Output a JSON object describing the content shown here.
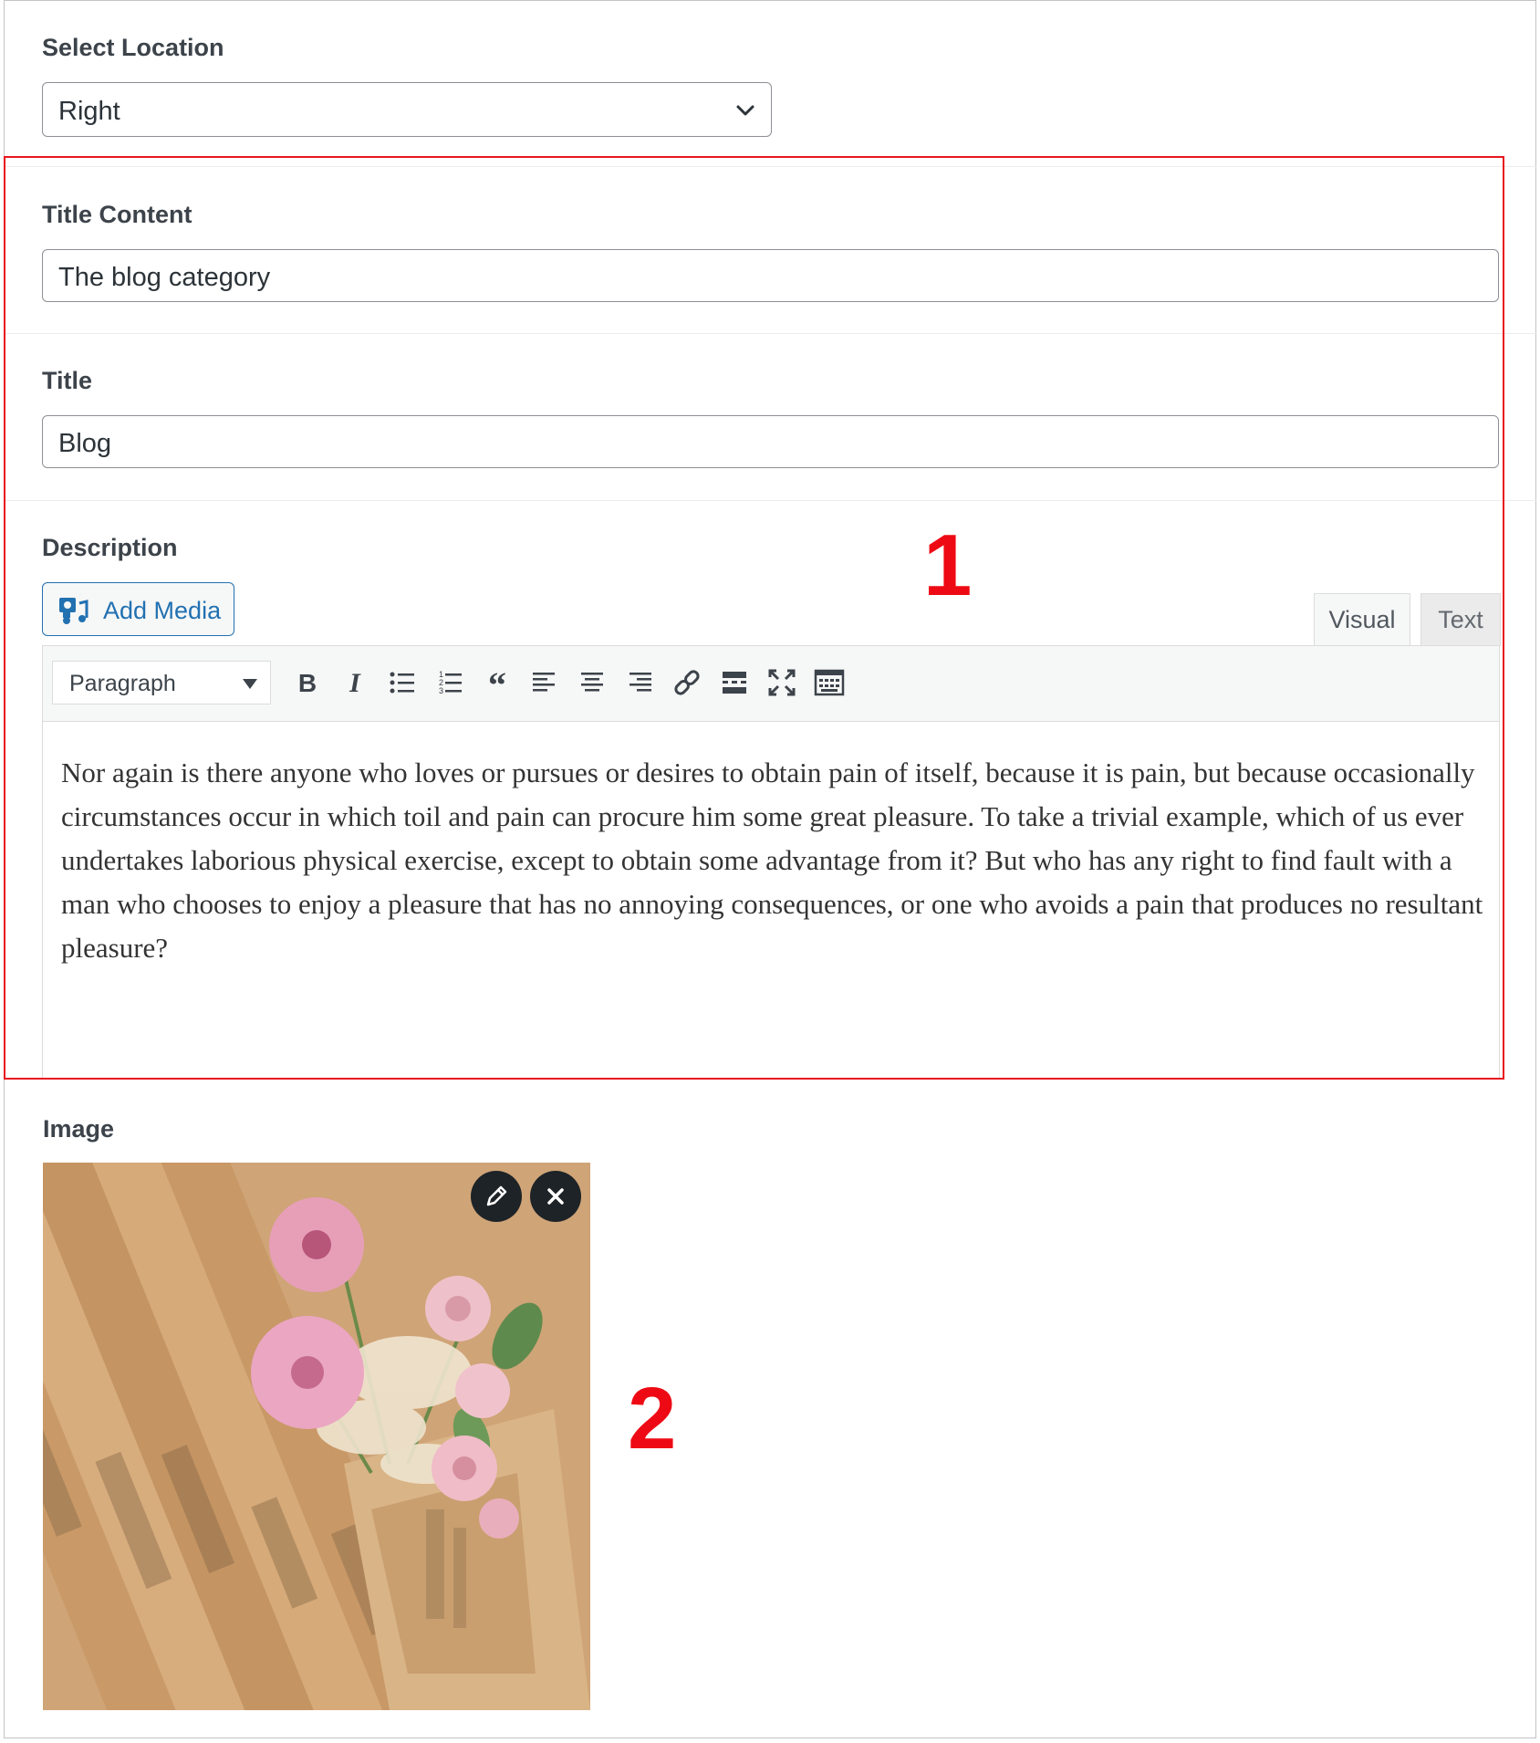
{
  "location": {
    "label": "Select Location",
    "selected": "Right",
    "icon": "chevron-down-icon"
  },
  "title_content": {
    "label": "Title Content",
    "value": "The blog category"
  },
  "title": {
    "label": "Title",
    "value": "Blog"
  },
  "description": {
    "label": "Description",
    "add_media_label": "Add Media",
    "tabs": {
      "visual": "Visual",
      "text": "Text"
    },
    "format_select": "Paragraph",
    "toolbar_icons": [
      "bold-icon",
      "italic-icon",
      "bulleted-list-icon",
      "numbered-list-icon",
      "blockquote-icon",
      "align-left-icon",
      "align-center-icon",
      "align-right-icon",
      "link-icon",
      "read-more-icon",
      "fullscreen-icon",
      "toolbar-toggle-icon"
    ],
    "content": "Nor again is there anyone who loves or pursues or desires to obtain pain of itself, because it is pain, but because occasionally circumstances occur in which toil and pain can procure him some great pleasure. To take a trivial example, which of us ever undertakes laborious physical exercise, except to obtain some advantage from it? But who has any right to find fault with a man who chooses to enjoy a pleasure that has no annoying consequences, or one who avoids a pain that produces no resultant pleasure?"
  },
  "image": {
    "label": "Image",
    "actions": [
      "edit-icon",
      "close-icon"
    ]
  },
  "annotations": {
    "marker_1": "1",
    "marker_2": "2",
    "highlight_color": "#e8151d"
  }
}
